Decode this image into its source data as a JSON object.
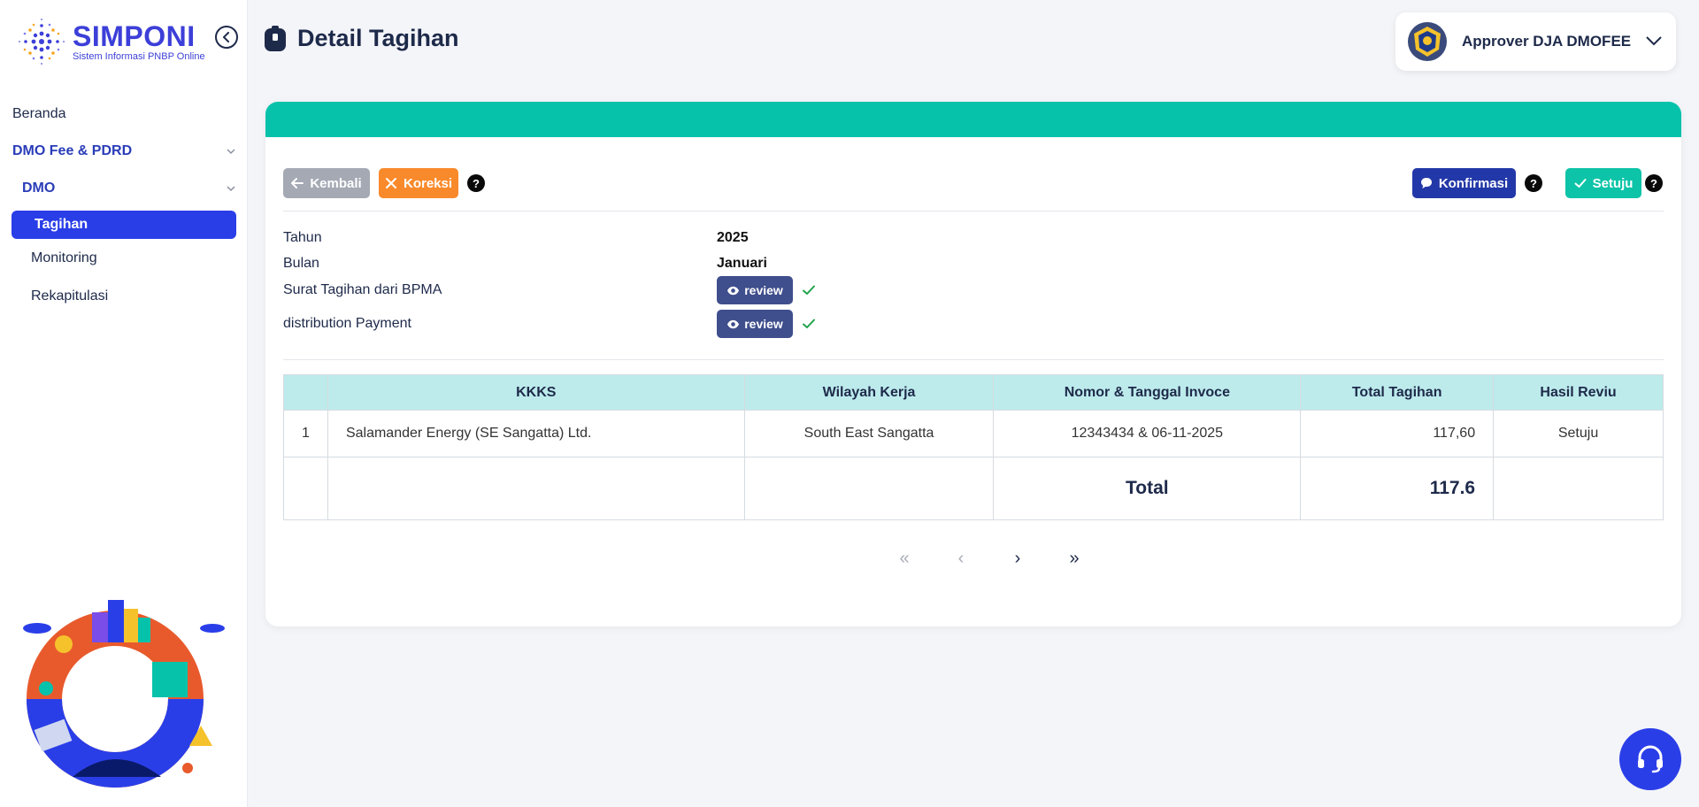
{
  "app": {
    "name": "SIMPONI",
    "tagline": "Sistem Informasi PNBP Online"
  },
  "sidebar": {
    "items": [
      {
        "label": "Beranda"
      },
      {
        "label": "DMO Fee & PDRD"
      },
      {
        "label": "DMO"
      },
      {
        "label": "Tagihan"
      },
      {
        "label": "Monitoring"
      },
      {
        "label": "Rekapitulasi"
      }
    ]
  },
  "header": {
    "title": "Detail Tagihan",
    "user": "Approver DJA DMOFEE"
  },
  "toolbar": {
    "back_label": "Kembali",
    "koreksi_label": "Koreksi",
    "konfirmasi_label": "Konfirmasi",
    "setuju_label": "Setuju",
    "help_glyph": "?"
  },
  "info": {
    "tahun_label": "Tahun",
    "tahun_value": "2025",
    "bulan_label": "Bulan",
    "bulan_value": "Januari",
    "surat_label": "Surat Tagihan dari BPMA",
    "distribution_label": "distribution Payment",
    "review_label": "review"
  },
  "table": {
    "headers": [
      "",
      "KKKS",
      "Wilayah Kerja",
      "Nomor & Tanggal Invoce",
      "Total Tagihan",
      "Hasil Reviu"
    ],
    "rows": [
      {
        "no": "1",
        "kkks": "Salamander Energy (SE Sangatta) Ltd.",
        "wilayah": "South East Sangatta",
        "invoice": "12343434 & 06-11-2025",
        "total": "117,60",
        "hasil": "Setuju"
      }
    ],
    "total_label": "Total",
    "total_value": "117.6"
  },
  "pager": {
    "first": "«",
    "prev": "‹",
    "next": "›",
    "last": "»"
  },
  "colors": {
    "accent": "#2a3ee8",
    "band": "#07c2ab",
    "koreksi": "#f98a2c",
    "konfirmasi": "#2338a8",
    "setuju": "#0ec4a8",
    "table_header": "#bdebec"
  }
}
